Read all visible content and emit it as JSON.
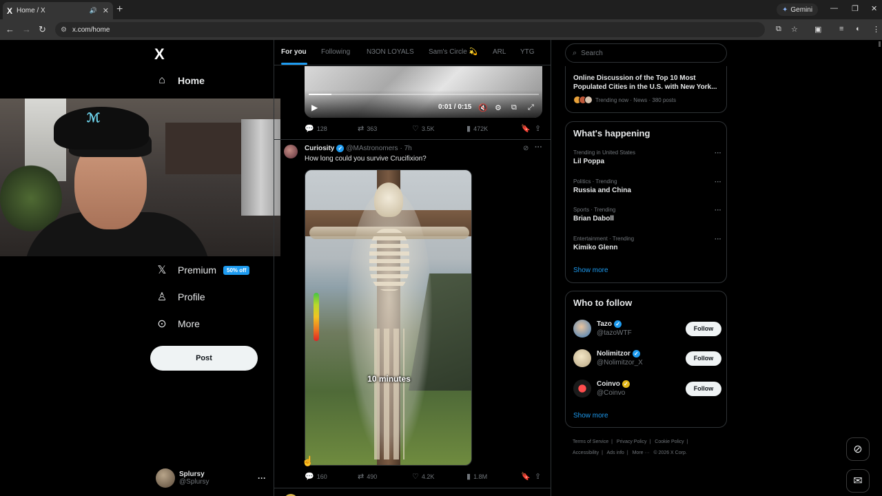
{
  "browser": {
    "tab_title": "Home / X",
    "tab_favicon": "X",
    "url": "x.com/home",
    "gemini_label": "Gemini"
  },
  "nav": {
    "logo": "X",
    "home": "Home",
    "premium": "Premium",
    "premium_badge": "50% off",
    "profile": "Profile",
    "more": "More",
    "post_button": "Post",
    "account": {
      "display_name": "Splursy",
      "handle": "@Splursy"
    }
  },
  "timeline": {
    "tabs": [
      "For you",
      "Following",
      "N3ON LOYALS",
      "Sam's Circle 💫",
      "ARL",
      "YTG"
    ],
    "active_tab_index": 0,
    "tweet1": {
      "video_time": "0:01 / 0:15",
      "video_progress": 0.1,
      "stats": {
        "replies": "128",
        "reposts": "363",
        "likes": "3.5K",
        "views": "472K"
      }
    },
    "tweet2": {
      "display_name": "Curiosity",
      "handle": "@MAstronomers",
      "time": "· 7h",
      "text": "How long could you survive Crucifixion?",
      "media_caption": "10 minutes",
      "stats": {
        "replies": "160",
        "reposts": "490",
        "likes": "4.2K",
        "views": "1.8M"
      }
    }
  },
  "sidebar": {
    "search_placeholder": "Search",
    "news": {
      "title": "Online Discussion of the Top 10 Most Populated Cities in the U.S. with New York...",
      "meta": "Trending now · News · 380 posts"
    },
    "whats_happening": {
      "heading": "What's happening",
      "trends": [
        {
          "context": "Trending in United States",
          "title": "Lil Poppa"
        },
        {
          "context": "Politics · Trending",
          "title": "Russia and China"
        },
        {
          "context": "Sports · Trending",
          "title": "Brian Daboll"
        },
        {
          "context": "Entertainment · Trending",
          "title": "Kimiko Glenn"
        }
      ],
      "show_more": "Show more"
    },
    "who_to_follow": {
      "heading": "Who to follow",
      "accounts": [
        {
          "name": "Tazo",
          "handle": "@tazoWTF",
          "badge": "blue"
        },
        {
          "name": "Nolimitzor",
          "handle": "@Nolimitzor_X",
          "badge": "blue"
        },
        {
          "name": "Coinvo",
          "handle": "@Coinvo",
          "badge": "gold"
        }
      ],
      "follow_label": "Follow",
      "show_more": "Show more"
    },
    "footer": [
      "Terms of Service",
      "|",
      "Privacy Policy",
      "|",
      "Cookie Policy",
      "|",
      "Accessibility",
      "|",
      "Ads info",
      "|",
      "More ···",
      "© 2026 X Corp."
    ]
  },
  "colors": {
    "accent": "#1d9bf0",
    "background": "#000000",
    "border": "#2f3336",
    "muted": "#71767b"
  }
}
